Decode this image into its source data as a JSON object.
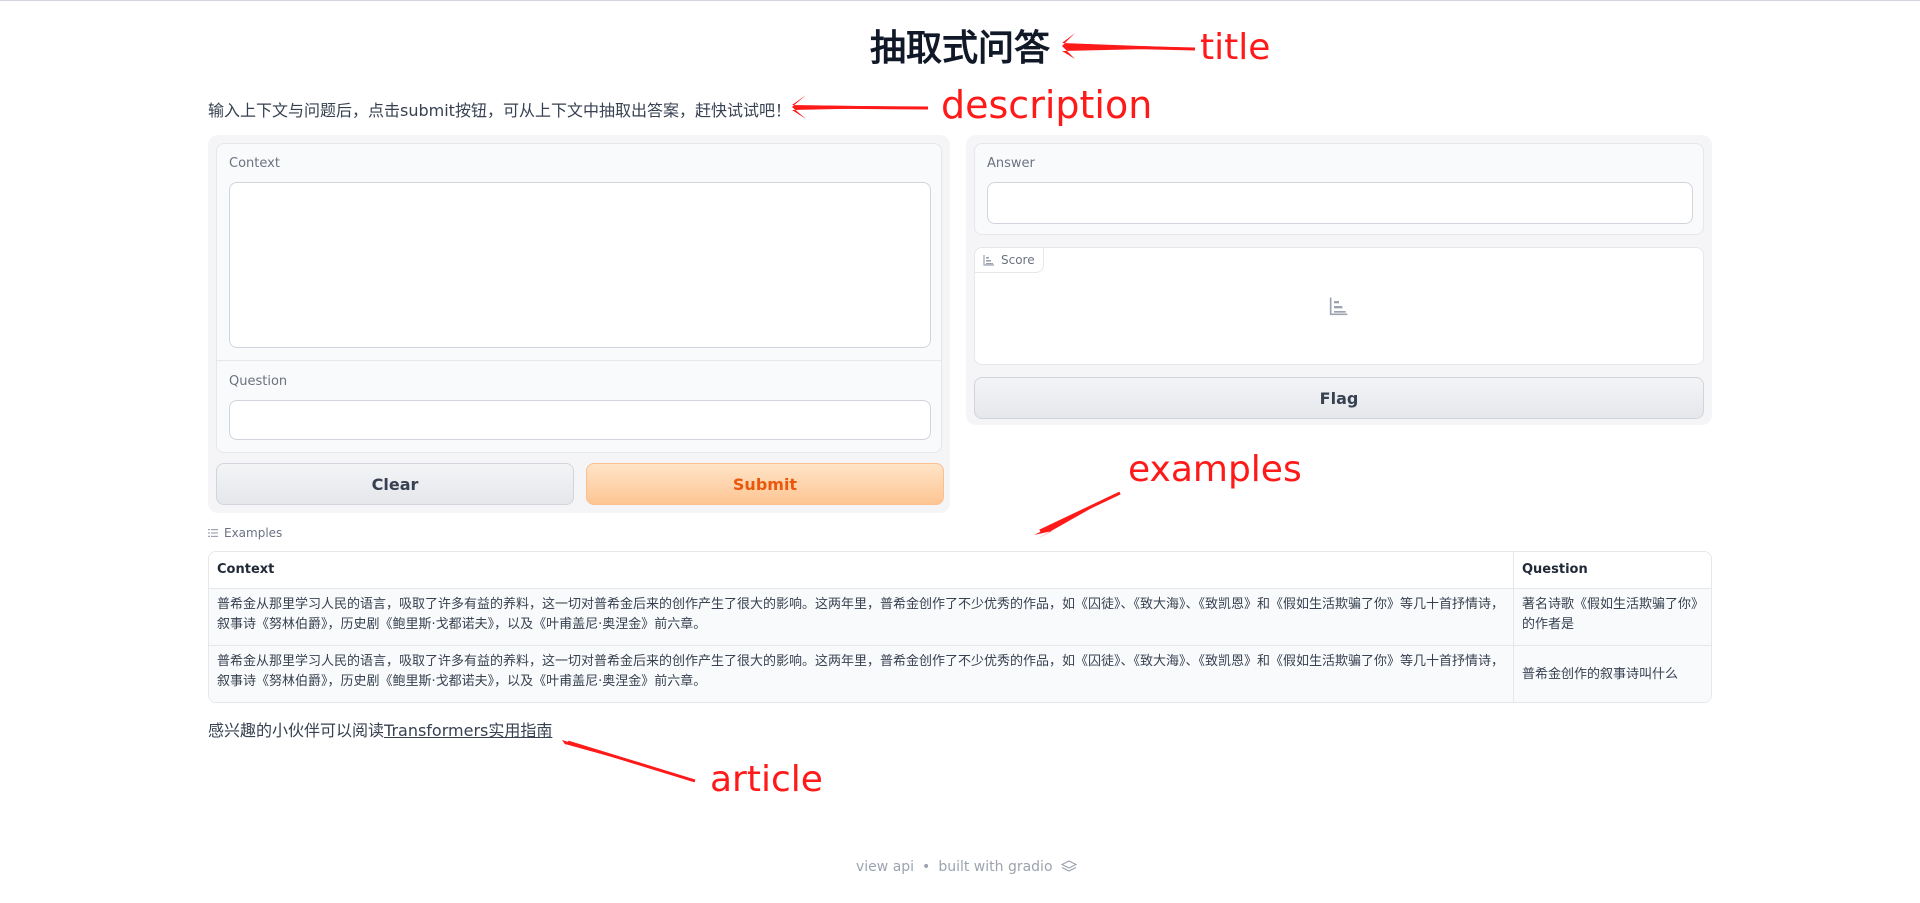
{
  "header": {
    "title": "抽取式问答",
    "description": "输入上下文与问题后，点击submit按钮，可从上下文中抽取出答案，赶快试试吧！"
  },
  "inputs": {
    "context_label": "Context",
    "context_value": "",
    "question_label": "Question",
    "question_value": ""
  },
  "outputs": {
    "answer_label": "Answer",
    "answer_value": "",
    "score_label": "Score"
  },
  "buttons": {
    "clear": "Clear",
    "submit": "Submit",
    "flag": "Flag"
  },
  "examples": {
    "label": "Examples",
    "columns": [
      "Context",
      "Question"
    ],
    "rows": [
      {
        "context": "普希金从那里学习人民的语言，吸取了许多有益的养料，这一切对普希金后来的创作产生了很大的影响。这两年里，普希金创作了不少优秀的作品，如《囚徒》、《致大海》、《致凯恩》和《假如生活欺骗了你》等几十首抒情诗，叙事诗《努林伯爵》，历史剧《鲍里斯·戈都诺夫》，以及《叶甫盖尼·奥涅金》前六章。",
        "question": "著名诗歌《假如生活欺骗了你》的作者是"
      },
      {
        "context": "普希金从那里学习人民的语言，吸取了许多有益的养料，这一切对普希金后来的创作产生了很大的影响。这两年里，普希金创作了不少优秀的作品，如《囚徒》、《致大海》、《致凯恩》和《假如生活欺骗了你》等几十首抒情诗，叙事诗《努林伯爵》，历史剧《鲍里斯·戈都诺夫》，以及《叶甫盖尼·奥涅金》前六章。",
        "question": "普希金创作的叙事诗叫什么"
      }
    ]
  },
  "article": {
    "prefix": "感兴趣的小伙伴可以阅读",
    "link_text": "Transformers实用指南"
  },
  "footer": {
    "view_api": "view api",
    "separator": "•",
    "built_with": "built with gradio"
  },
  "annotations": {
    "title": "title",
    "description": "description",
    "examples": "examples",
    "article": "article"
  },
  "colors": {
    "annotation": "#ff1a1a",
    "primary_button_bg": "#fdc593",
    "primary_button_text": "#ea580c"
  },
  "icons": {
    "score": "bar-chart-icon",
    "examples": "list-icon",
    "footer": "gradio-logo-icon"
  }
}
